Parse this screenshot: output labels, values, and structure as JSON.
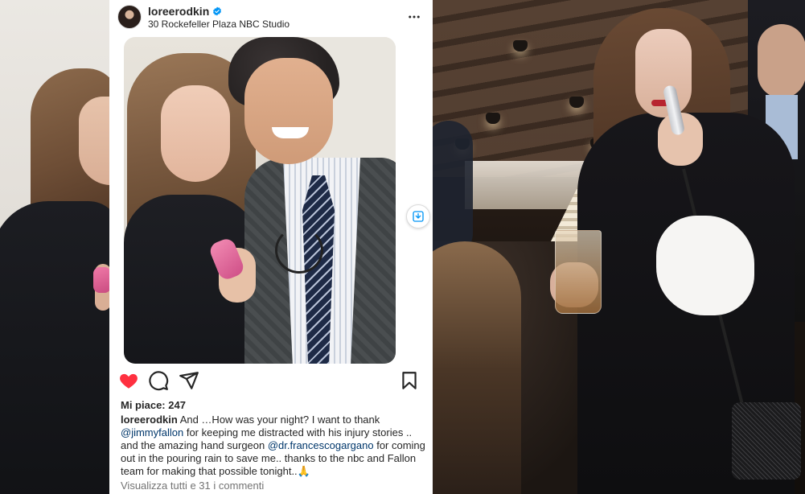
{
  "post": {
    "username": "loreerodkin",
    "location": "30 Rockefeller Plaza NBC Studio",
    "likes_label": "Mi piace: 247",
    "caption": {
      "username": "loreerodkin",
      "part1": " And …How was your night? I want to thank ",
      "mention1": "@jimmyfallon",
      "part2": " for keeping me distracted with his injury stories .. and the amazing hand surgeon ",
      "mention2": "@dr.francescogargano",
      "part3": " for coming out in the pouring rain to save me.. thanks to the nbc and Fallon team for making that possible tonight..",
      "emoji": "🙏"
    },
    "comments_link": "Visualizza tutti e 31 i commenti"
  },
  "icons": {
    "verified": "verified-badge-icon",
    "more": "more-options-icon",
    "like": "heart-icon",
    "comment": "comment-icon",
    "share": "share-icon",
    "save": "bookmark-icon",
    "side_save": "save-download-icon"
  },
  "colors": {
    "heart": "#ff3040",
    "verified": "#0095f6",
    "mention": "#00376b",
    "muted": "#737373"
  }
}
